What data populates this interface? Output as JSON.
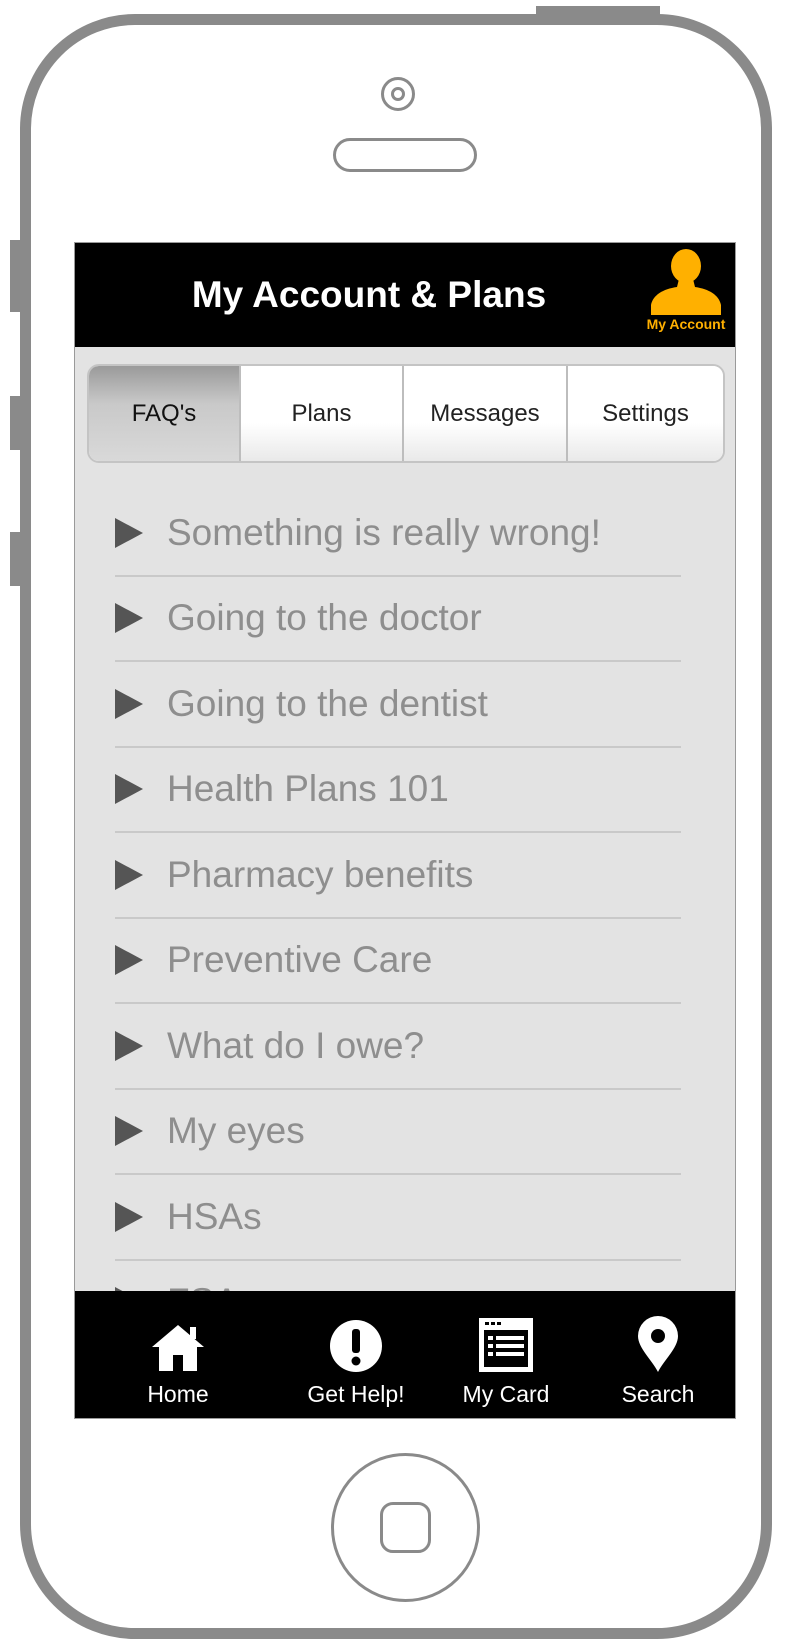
{
  "header": {
    "title": "My Account & Plans",
    "account_label": "My Account"
  },
  "segments": [
    {
      "label": "FAQ's",
      "active": true
    },
    {
      "label": "Plans",
      "active": false
    },
    {
      "label": "Messages",
      "active": false
    },
    {
      "label": "Settings",
      "active": false
    }
  ],
  "faq_items": [
    "Something is really wrong!",
    "Going to the doctor",
    "Going to the dentist",
    "Health Plans 101",
    "Pharmacy benefits",
    "Preventive Care",
    "What do I owe?",
    "My eyes",
    "HSAs",
    "FSAs"
  ],
  "tabbar": {
    "home": "Home",
    "help": "Get Help!",
    "card": "My Card",
    "search": "Search"
  },
  "colors": {
    "header_bg": "#000000",
    "accent": "#ffb000",
    "list_bg": "#e3e3e3",
    "list_text": "#8e8e8e"
  }
}
